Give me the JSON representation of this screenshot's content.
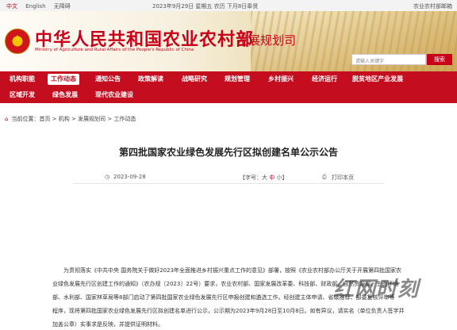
{
  "topbar": {
    "lang_zh": "中文",
    "lang_en": "English",
    "accessible": "无障碍",
    "date": "2023年9月29日 星期五 农历 下月8日奉贤",
    "portal": "农业农村部邮箱"
  },
  "header": {
    "title": "中华人民共和国农业农村部",
    "subtitle": "Ministry of Agriculture and Rural Affairs of the People's Republic of China",
    "department": "发展规划司",
    "search_placeholder": "请输入关键字",
    "search_button": "搜索"
  },
  "nav": {
    "row1": [
      "机构职能",
      "工作动态",
      "通知公告",
      "政策解读",
      "战略研究",
      "规划管理",
      "乡村振兴",
      "经济运行",
      "脱贫地区产业发展"
    ],
    "row2": [
      "区域开发",
      "绿色发展",
      "现代农业建设"
    ],
    "active": "工作动态"
  },
  "breadcrumb": {
    "label": "当前位置：",
    "items": [
      "首页",
      "机构",
      "发展规划司",
      "工作动态"
    ]
  },
  "article": {
    "title": "第四批国家农业绿色发展先行区拟创建名单公示公告",
    "date": "2023-09-28",
    "font_label": "【字号：",
    "font_big": "大",
    "font_mid": "中",
    "font_small": "小",
    "font_end": "】",
    "print": "打印本页",
    "lines": [
      "为贯彻落实《中共中央 国务院关于做好2023年全面推进乡村振兴重点工作的意见》部署，按照《农业农村部办公厅关于开展第四批国家农",
      "业绿色发展先行区创建工作的通知》（农办规〔2023〕22号）要求，农业农村部、国家发展改革委、科技部、财政部、自然资源部、生态环境",
      "部、水利部、国家林草局等8部门启动了第四批国家农业绿色发展先行区申报创建和遴选工作。经创建主体申请、省级推荐、部委复核评审等",
      "程序，现将第四批国家农业绿色发展先行区拟创建名单进行公示，公示期为2023年9月28日至10月8日。如有异议，请实名（单位负责人签字并",
      "加盖公章）实事求是反映，并提供证明材料。"
    ]
  },
  "watermark": {
    "main": "红网",
    "sub": "时刻"
  },
  "colors": {
    "brand_red": "#c40d1f",
    "title_red": "#c8001a"
  }
}
